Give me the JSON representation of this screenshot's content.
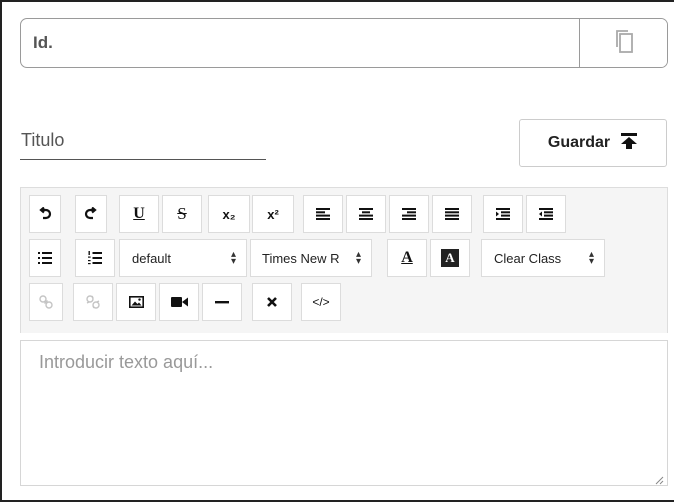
{
  "id_field": {
    "placeholder": "Id.",
    "copy_icon": "copy-icon"
  },
  "title_field": {
    "placeholder": "Titulo"
  },
  "save_button": {
    "label": "Guardar",
    "icon": "upload-to-top-icon"
  },
  "toolbar": {
    "row1": [
      "undo-icon",
      "redo-icon",
      "underline-icon",
      "strikethrough-icon",
      "subscript-icon",
      "superscript-icon",
      "align-left-icon",
      "align-center-icon",
      "align-right-icon",
      "align-justify-icon",
      "indent-icon",
      "outdent-icon"
    ],
    "subscript_label": "x₂",
    "superscript_label": "x²",
    "underline_label": "U",
    "strike_label": "S",
    "format_select": "default",
    "font_select": "Times New R",
    "font_color_label": "A",
    "bg_color_label": "A",
    "class_select": "Clear Class",
    "row3": [
      "link-icon",
      "unlink-icon",
      "image-icon",
      "video-icon",
      "horizontal-rule-icon",
      "clear-format-icon",
      "code-view-icon"
    ],
    "code_label": "</>"
  },
  "editor": {
    "placeholder": "Introducir texto aquí..."
  }
}
